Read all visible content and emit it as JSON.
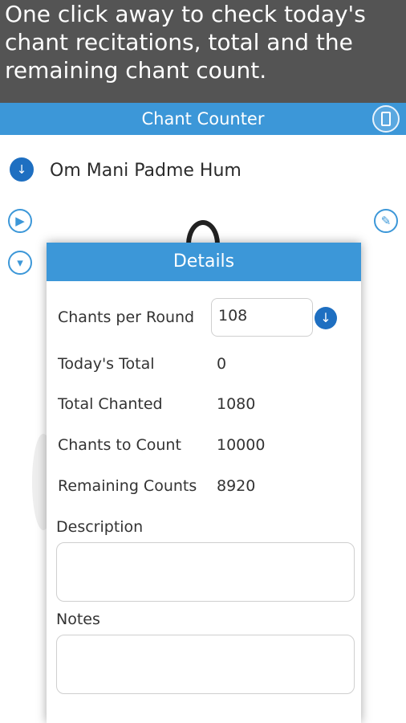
{
  "promo": {
    "line1": "One click away to check today's",
    "line2": "chant recitations, total and the",
    "line3": "remaining chant count."
  },
  "appbar": {
    "title": "Chant Counter"
  },
  "chant": {
    "name": "Om Mani Padme Hum"
  },
  "dialog": {
    "title": "Details",
    "chants_per_round_label": "Chants per Round",
    "chants_per_round_value": "108",
    "todays_total_label": "Today's Total",
    "todays_total_value": "0",
    "total_chanted_label": "Total Chanted",
    "total_chanted_value": "1080",
    "chants_to_count_label": "Chants to Count",
    "chants_to_count_value": "10000",
    "remaining_label": "Remaining Counts",
    "remaining_value": "8920",
    "description_label": "Description",
    "description_value": "",
    "notes_label": "Notes",
    "notes_value": ""
  }
}
